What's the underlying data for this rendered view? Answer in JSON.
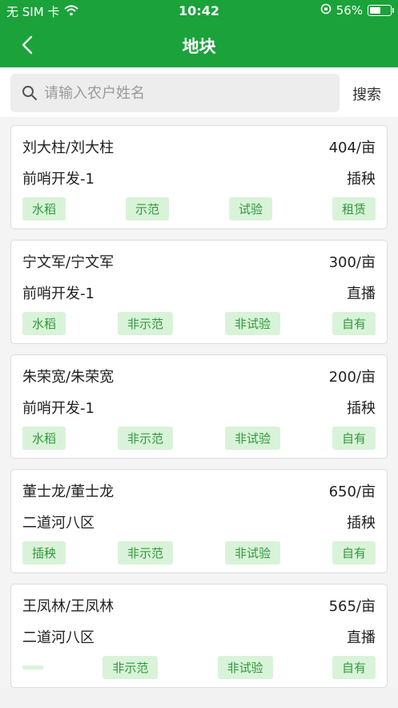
{
  "status": {
    "carrier": "无 SIM 卡",
    "time": "10:42",
    "battery": "56%",
    "battery_level": 0.56
  },
  "nav": {
    "title": "地块"
  },
  "search": {
    "placeholder": "请输入农户姓名",
    "button": "搜索"
  },
  "plots": [
    {
      "name": "刘大柱/刘大柱",
      "area": "404/亩",
      "location": "前哨开发-1",
      "method": "插秧",
      "tags": [
        "水稻",
        "示范",
        "试验",
        "租赁"
      ]
    },
    {
      "name": "宁文军/宁文军",
      "area": "300/亩",
      "location": "前哨开发-1",
      "method": "直播",
      "tags": [
        "水稻",
        "非示范",
        "非试验",
        "自有"
      ]
    },
    {
      "name": "朱荣宽/朱荣宽",
      "area": "200/亩",
      "location": "前哨开发-1",
      "method": "插秧",
      "tags": [
        "水稻",
        "非示范",
        "非试验",
        "自有"
      ]
    },
    {
      "name": "董士龙/董士龙",
      "area": "650/亩",
      "location": "二道河八区",
      "method": "插秧",
      "tags": [
        "插秧",
        "非示范",
        "非试验",
        "自有"
      ]
    },
    {
      "name": "王凤林/王凤林",
      "area": "565/亩",
      "location": "二道河八区",
      "method": "直播",
      "tags": [
        "",
        "非示范",
        "非试验",
        "自有"
      ]
    }
  ]
}
